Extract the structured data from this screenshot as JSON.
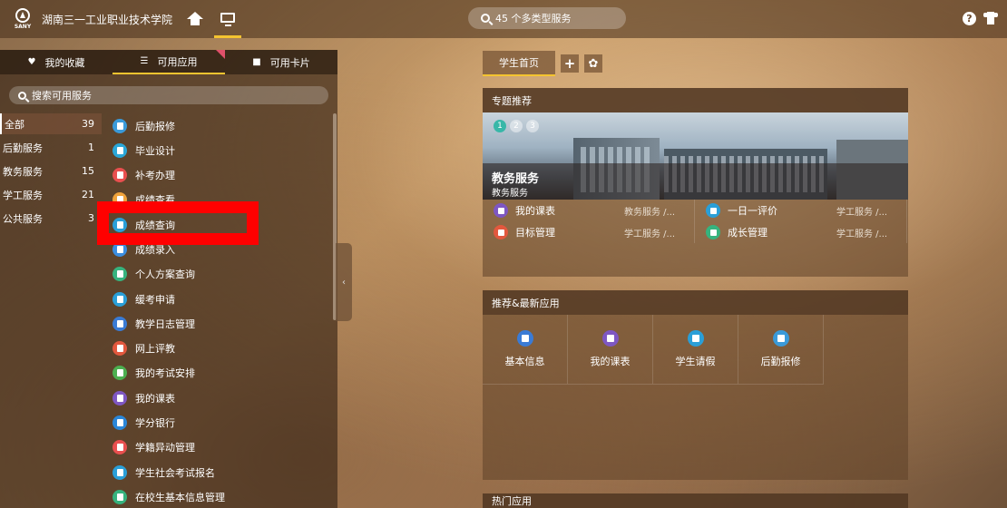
{
  "topbar": {
    "logo_text": "SANY",
    "school_name": "湖南三一工业职业技术学院",
    "search_text": "45 个多类型服务",
    "help_label": "?"
  },
  "left": {
    "tabs": [
      {
        "label": "我的收藏",
        "icon": "heart-icon"
      },
      {
        "label": "可用应用",
        "icon": "list-icon"
      },
      {
        "label": "可用卡片",
        "icon": "grid-icon"
      }
    ],
    "search_placeholder": "搜索可用服务",
    "categories": [
      {
        "label": "全部",
        "count": "39"
      },
      {
        "label": "后勤服务",
        "count": "1"
      },
      {
        "label": "教务服务",
        "count": "15"
      },
      {
        "label": "学工服务",
        "count": "21"
      },
      {
        "label": "公共服务",
        "count": "3"
      }
    ],
    "apps": [
      {
        "label": "后勤报修",
        "color": "#3a9ad9"
      },
      {
        "label": "毕业设计",
        "color": "#2aa7d8"
      },
      {
        "label": "补考办理",
        "color": "#e94f4f"
      },
      {
        "label": "成绩查看",
        "color": "#f0a23b"
      },
      {
        "label": "成绩查询",
        "color": "#2a9fd8"
      },
      {
        "label": "成绩录入",
        "color": "#3b8de0"
      },
      {
        "label": "个人方案查询",
        "color": "#36b37e"
      },
      {
        "label": "缓考申请",
        "color": "#2a9fd8"
      },
      {
        "label": "教学日志管理",
        "color": "#3a7bd5"
      },
      {
        "label": "网上评教",
        "color": "#e2583e"
      },
      {
        "label": "我的考试安排",
        "color": "#4caf50"
      },
      {
        "label": "我的课表",
        "color": "#7e57c2"
      },
      {
        "label": "学分银行",
        "color": "#2a86d8"
      },
      {
        "label": "学籍异动管理",
        "color": "#e94f4f"
      },
      {
        "label": "学生社会考试报名",
        "color": "#2a9fd8"
      },
      {
        "label": "在校生基本信息管理",
        "color": "#36b37e"
      }
    ],
    "collapse_glyph": "‹"
  },
  "right": {
    "tab_label": "学生首页",
    "add_glyph": "+",
    "gear_glyph": "✿",
    "featured": {
      "title": "专题推荐",
      "dots": [
        "1",
        "2",
        "3"
      ],
      "banner_title": "教务服务",
      "banner_sub": "教务服务",
      "items": [
        [
          {
            "name": "我的课表",
            "cat": "教务服务 /...",
            "color": "#7e57c2"
          },
          {
            "name": "一日一评价",
            "cat": "学工服务 /...",
            "color": "#2a9fd8"
          }
        ],
        [
          {
            "name": "目标管理",
            "cat": "学工服务 /...",
            "color": "#e2583e"
          },
          {
            "name": "成长管理",
            "cat": "学工服务 /...",
            "color": "#36b37e"
          }
        ]
      ]
    },
    "recommend": {
      "title": "推荐&最新应用",
      "items": [
        {
          "label": "基本信息",
          "color": "#3a7bd5"
        },
        {
          "label": "我的课表",
          "color": "#7e57c2"
        },
        {
          "label": "学生请假",
          "color": "#2a9fd8"
        },
        {
          "label": "后勤报修",
          "color": "#3a9ad9"
        }
      ]
    },
    "hot": {
      "title": "热门应用"
    }
  }
}
